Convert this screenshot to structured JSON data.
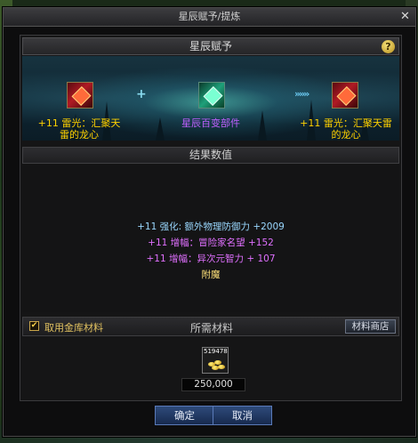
{
  "window": {
    "title": "星辰赋予/提炼",
    "close_glyph": "✕"
  },
  "panel": {
    "header": "星辰赋予",
    "help_glyph": "?"
  },
  "banner": {
    "left_item": "+11 雷光：汇聚天雷的龙心",
    "center_item": "星辰百变部件",
    "right_item": "+11 雷光：汇聚天雷的龙心",
    "plus_glyph": "+",
    "arrow_glyph": "»»»"
  },
  "results": {
    "title": "结果数值",
    "lines": [
      "+11 强化: 额外物理防御力 +2009",
      "+11 增幅：冒险家名望 +152",
      "+11 增幅：异次元智力 + 107",
      "附魔"
    ]
  },
  "materials": {
    "checkbox_label": "取用金库材料",
    "checkbox_checked": true,
    "title": "所需材料",
    "shop_button": "材料商店",
    "item_count": "519478",
    "cost": "250,000"
  },
  "buttons": {
    "confirm": "确定",
    "cancel": "取消"
  },
  "colors": {
    "gold_text": "#ffd200",
    "epic_purple": "#c060ff",
    "blue_text": "#9ad8ff",
    "button_blue": "#2e4a7a"
  },
  "icons": {
    "close": "close-icon",
    "help": "help-icon",
    "checkbox": "check-icon",
    "item": "dragon-heart-icon",
    "material": "gold-coin-icon"
  }
}
